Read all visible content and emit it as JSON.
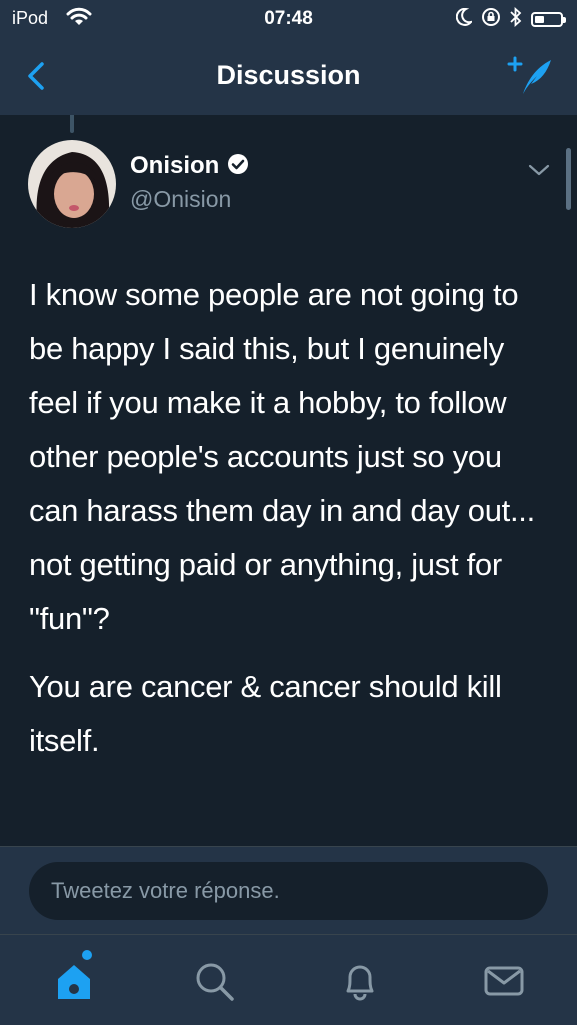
{
  "status_bar": {
    "carrier": "iPod",
    "time": "07:48"
  },
  "nav": {
    "title": "Discussion",
    "back_icon": "chevron-left-icon",
    "compose_icon": "compose-tweet-icon"
  },
  "tweet": {
    "display_name": "Onision",
    "handle": "@Onision",
    "verified": true,
    "paragraphs": [
      "I know some people are not going to be happy I said this, but I genuinely feel if you make it a hobby, to follow other people's accounts just so you can harass them day in and day out... not getting paid or anything, just for \"fun\"?",
      "You are cancer & cancer should kill itself."
    ]
  },
  "reply": {
    "placeholder": "Tweetez votre réponse."
  },
  "tab_bar": {
    "tabs": [
      "home-icon",
      "search-icon",
      "notifications-icon",
      "messages-icon"
    ],
    "active": "home-icon",
    "has_new_dot": true
  },
  "colors": {
    "background": "#15202b",
    "bar": "#243447",
    "accent": "#1da1f2",
    "secondary_text": "#8899a6"
  }
}
